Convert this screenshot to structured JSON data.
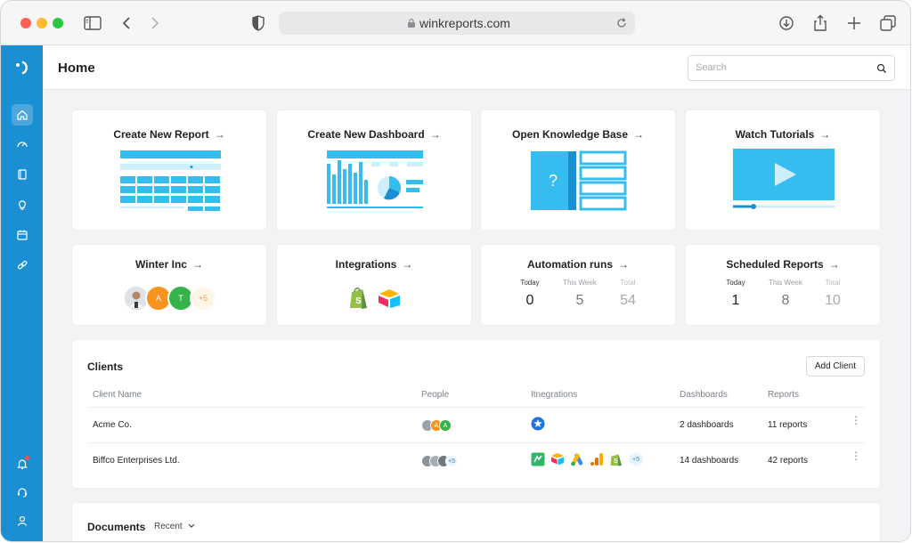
{
  "browser": {
    "url": "winkreports.com"
  },
  "topbar": {
    "title": "Home",
    "search_placeholder": "Search"
  },
  "rail": {
    "logo": "winkreports-logo-icon",
    "items": [
      {
        "icon": "home-icon",
        "active": true
      },
      {
        "icon": "dashboard-gauge-icon",
        "active": false
      },
      {
        "icon": "book-icon",
        "active": false
      },
      {
        "icon": "lightbulb-icon",
        "active": false
      },
      {
        "icon": "calendar-icon",
        "active": false
      },
      {
        "icon": "link-icon",
        "active": false
      }
    ],
    "bottom_items": [
      {
        "icon": "bell-icon",
        "notification": true
      },
      {
        "icon": "headset-icon"
      },
      {
        "icon": "user-icon"
      }
    ]
  },
  "quick_actions": [
    {
      "title": "Create New Report",
      "icon": "report-illustration"
    },
    {
      "title": "Create New Dashboard",
      "icon": "dashboard-illustration"
    },
    {
      "title": "Open Knowledge Base",
      "icon": "knowledge-base-illustration"
    },
    {
      "title": "Watch Tutorials",
      "icon": "video-illustration"
    }
  ],
  "summary": {
    "winter": {
      "title": "Winter Inc",
      "avatars": [
        {
          "type": "photo"
        },
        {
          "initial": "A",
          "color": "#f7931e"
        },
        {
          "initial": "T",
          "color": "#35b34a"
        },
        {
          "initial": "+5",
          "color": "#fff6e8"
        }
      ]
    },
    "integrations": {
      "title": "Integrations",
      "icons": [
        "shopify-icon",
        "airtable-icon"
      ]
    },
    "automation": {
      "title": "Automation runs",
      "labels": {
        "today": "Today",
        "week": "This Week",
        "total": "Total"
      },
      "values": {
        "today": "0",
        "week": "5",
        "total": "54"
      }
    },
    "scheduled": {
      "title": "Scheduled Reports",
      "labels": {
        "today": "Today",
        "week": "This Week",
        "total": "Total"
      },
      "values": {
        "today": "1",
        "week": "8",
        "total": "10"
      }
    }
  },
  "clients": {
    "title": "Clients",
    "add_button": "Add Client",
    "headers": [
      "Client Name",
      "People",
      "Itnegrations",
      "Dashboards",
      "Reports"
    ],
    "rows": [
      {
        "name": "Acme Co.",
        "people": [
          "photo",
          "A",
          "A"
        ],
        "integrations": [
          "zapier-icon"
        ],
        "dashboards": "2 dashboards",
        "reports": "11 reports"
      },
      {
        "name": "Biffco Enterprises Ltd.",
        "people": [
          "photo",
          "photo",
          "photo",
          "+5"
        ],
        "integrations": [
          "green-icon",
          "airtable-icon",
          "google-ads-icon",
          "analytics-icon",
          "shopify-icon",
          "+5"
        ],
        "dashboards": "14 dashboards",
        "reports": "42 reports"
      }
    ]
  },
  "documents": {
    "title": "Documents",
    "filter": "Recent"
  },
  "colors": {
    "brand": "#1b8fd4",
    "accent_light": "#35bdf0",
    "background": "#f1f3f5",
    "card": "#ffffff"
  }
}
